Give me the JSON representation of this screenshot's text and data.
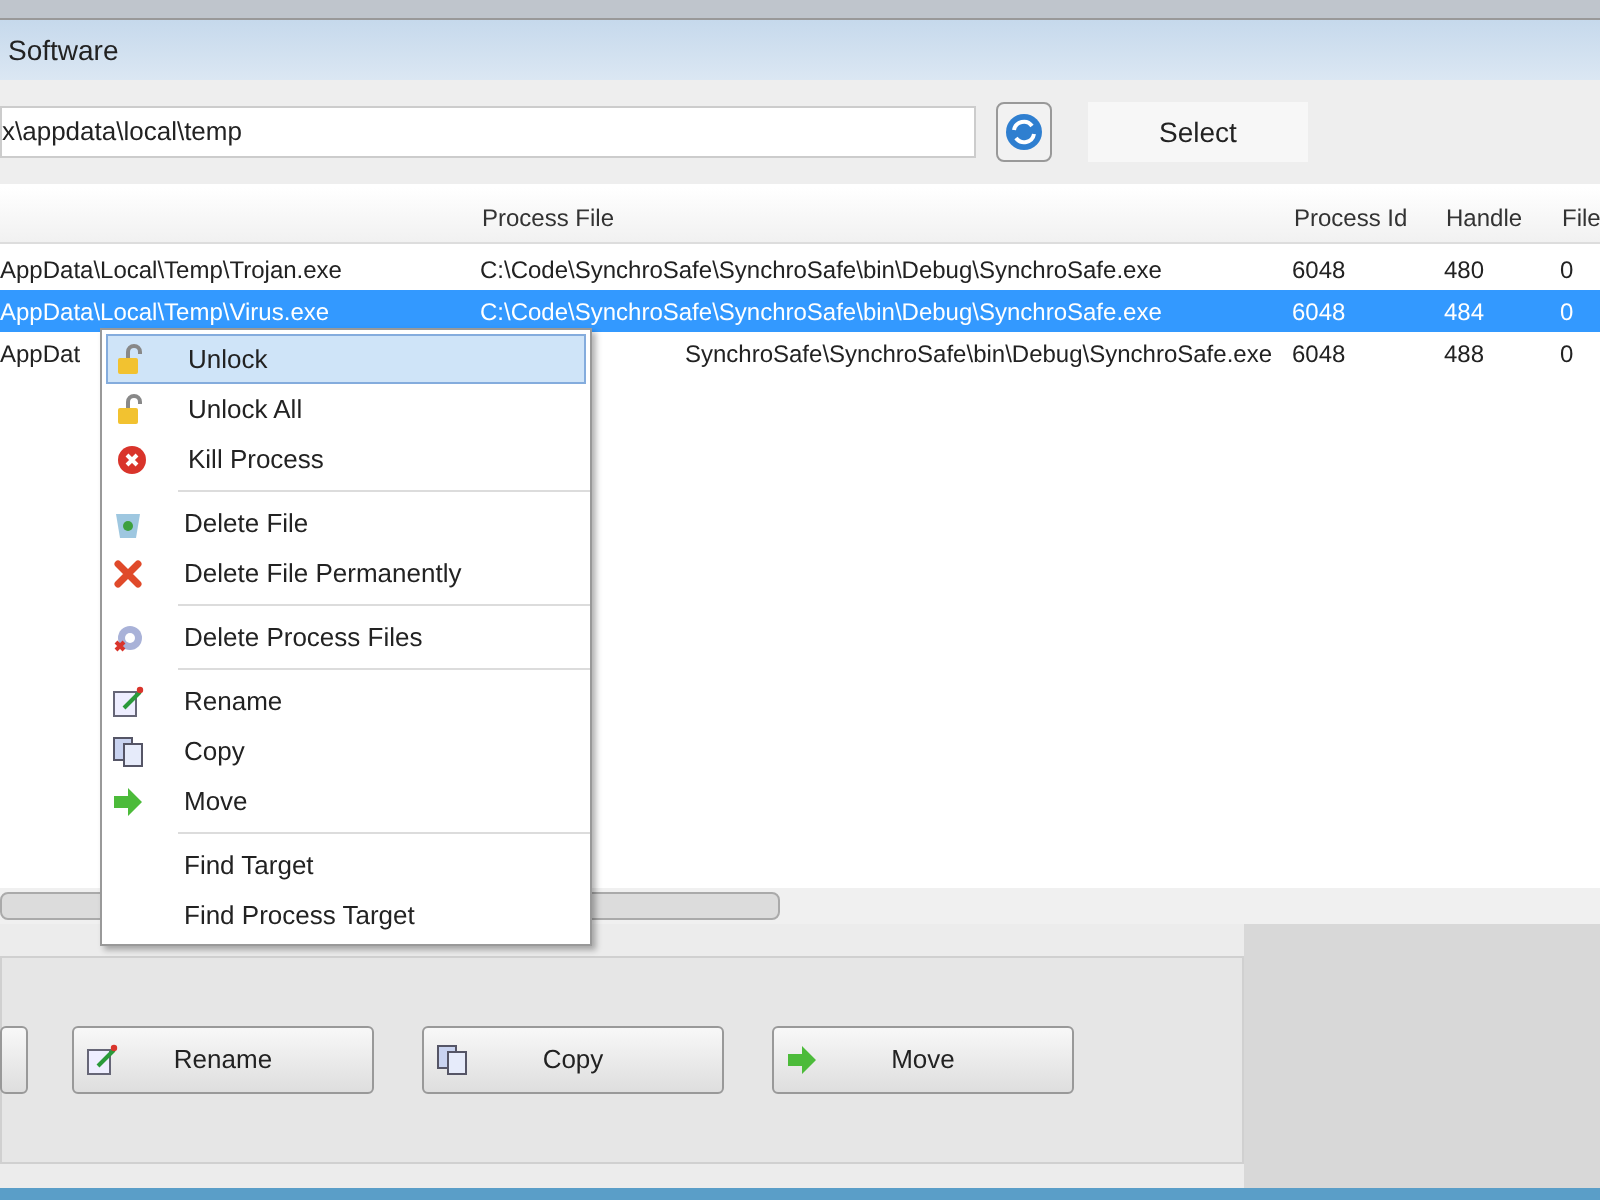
{
  "window": {
    "title": "Software"
  },
  "toolbar": {
    "path": "x\\appdata\\local\\temp",
    "select_button": "Select"
  },
  "table": {
    "columns": [
      "",
      "Process File",
      "Process Id",
      "Handle",
      "File"
    ],
    "rows": [
      {
        "selected": false,
        "kind": "full",
        "cells": [
          "AppData\\Local\\Temp\\Trojan.exe",
          "C:\\Code\\SynchroSafe\\SynchroSafe\\bin\\Debug\\SynchroSafe.exe",
          "6048",
          "480",
          "0"
        ]
      },
      {
        "selected": true,
        "kind": "full",
        "cells": [
          "AppData\\Local\\Temp\\Virus.exe",
          "C:\\Code\\SynchroSafe\\SynchroSafe\\bin\\Debug\\SynchroSafe.exe",
          "6048",
          "484",
          "0"
        ]
      },
      {
        "selected": false,
        "kind": "covered",
        "cells": [
          "AppDat",
          "SynchroSafe\\SynchroSafe\\bin\\Debug\\SynchroSafe.exe",
          "6048",
          "488",
          "0"
        ]
      }
    ]
  },
  "context_menu": {
    "groups": [
      [
        {
          "label": "Unlock",
          "kind": "lock",
          "selected": true
        },
        {
          "label": "Unlock All",
          "kind": "lock",
          "selected": false
        },
        {
          "label": "Kill Process",
          "kind": "stop",
          "selected": false
        }
      ],
      [
        {
          "label": "Delete File",
          "kind": "bin",
          "selected": false
        },
        {
          "label": "Delete File Permanently",
          "kind": "cross",
          "selected": false
        }
      ],
      [
        {
          "label": "Delete Process Files",
          "kind": "gear",
          "selected": false
        }
      ],
      [
        {
          "label": "Rename",
          "kind": "rename",
          "selected": false
        },
        {
          "label": "Copy",
          "kind": "copy",
          "selected": false
        },
        {
          "label": "Move",
          "kind": "move",
          "selected": false
        }
      ],
      [
        {
          "label": "Find Target",
          "kind": "none",
          "selected": false
        },
        {
          "label": "Find Process Target",
          "kind": "none",
          "selected": false
        }
      ]
    ]
  },
  "bottom_buttons": [
    {
      "kind": "partial"
    },
    {
      "label": "Rename",
      "kind": "rename"
    },
    {
      "label": "Copy",
      "kind": "copy"
    },
    {
      "label": "Move",
      "kind": "move"
    }
  ]
}
